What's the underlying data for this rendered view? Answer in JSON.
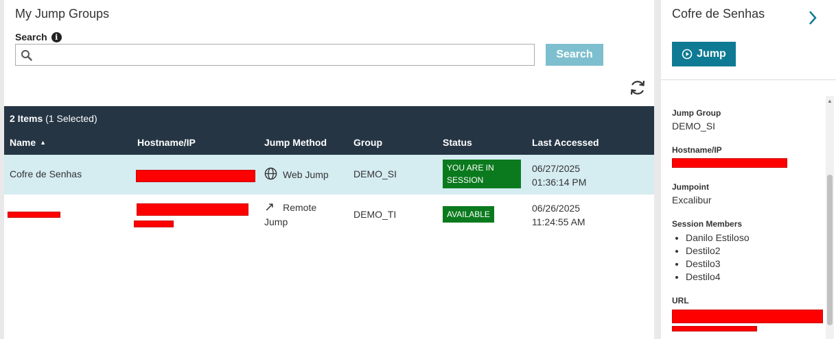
{
  "left_panel": {
    "title": "My Jump Groups",
    "search_label": "Search",
    "search_placeholder": "",
    "search_button": "Search",
    "refresh_icon": "refresh-icon"
  },
  "table": {
    "count_bold": "2 Items",
    "count_rest": "(1 Selected)",
    "columns": [
      "Name",
      "Hostname/IP",
      "Jump Method",
      "Group",
      "Status",
      "Last Accessed"
    ],
    "rows": [
      {
        "name": "Cofre de Senhas",
        "method": "Web Jump",
        "group": "DEMO_SI",
        "status": "YOU ARE IN SESSION",
        "date": "06/27/2025",
        "time": "01:36:14 PM"
      },
      {
        "name": "",
        "method": "Remote Jump",
        "method_line1": "Remote",
        "method_line2": "Jump",
        "group": "DEMO_TI",
        "status": "AVAILABLE",
        "date": "06/26/2025",
        "time": "11:24:55 AM"
      }
    ]
  },
  "right_panel": {
    "title": "Cofre de Senhas",
    "jump_button": "Jump",
    "jump_group_label": "Jump Group",
    "jump_group_value": "DEMO_SI",
    "hostname_label": "Hostname/IP",
    "jumpoint_label": "Jumpoint",
    "jumpoint_value": "Excalibur",
    "members_label": "Session Members",
    "members": [
      "Danilo Estiloso",
      "Destilo2",
      "Destilo3",
      "Destilo4"
    ],
    "url_label": "URL"
  },
  "colors": {
    "header_bg": "#253544",
    "selected_row": "#d5ecf1",
    "search_button": "#7dbfcf",
    "jump_button": "#0e7a93",
    "status_green": "#0b7a1e",
    "redaction": "#ff0000"
  }
}
